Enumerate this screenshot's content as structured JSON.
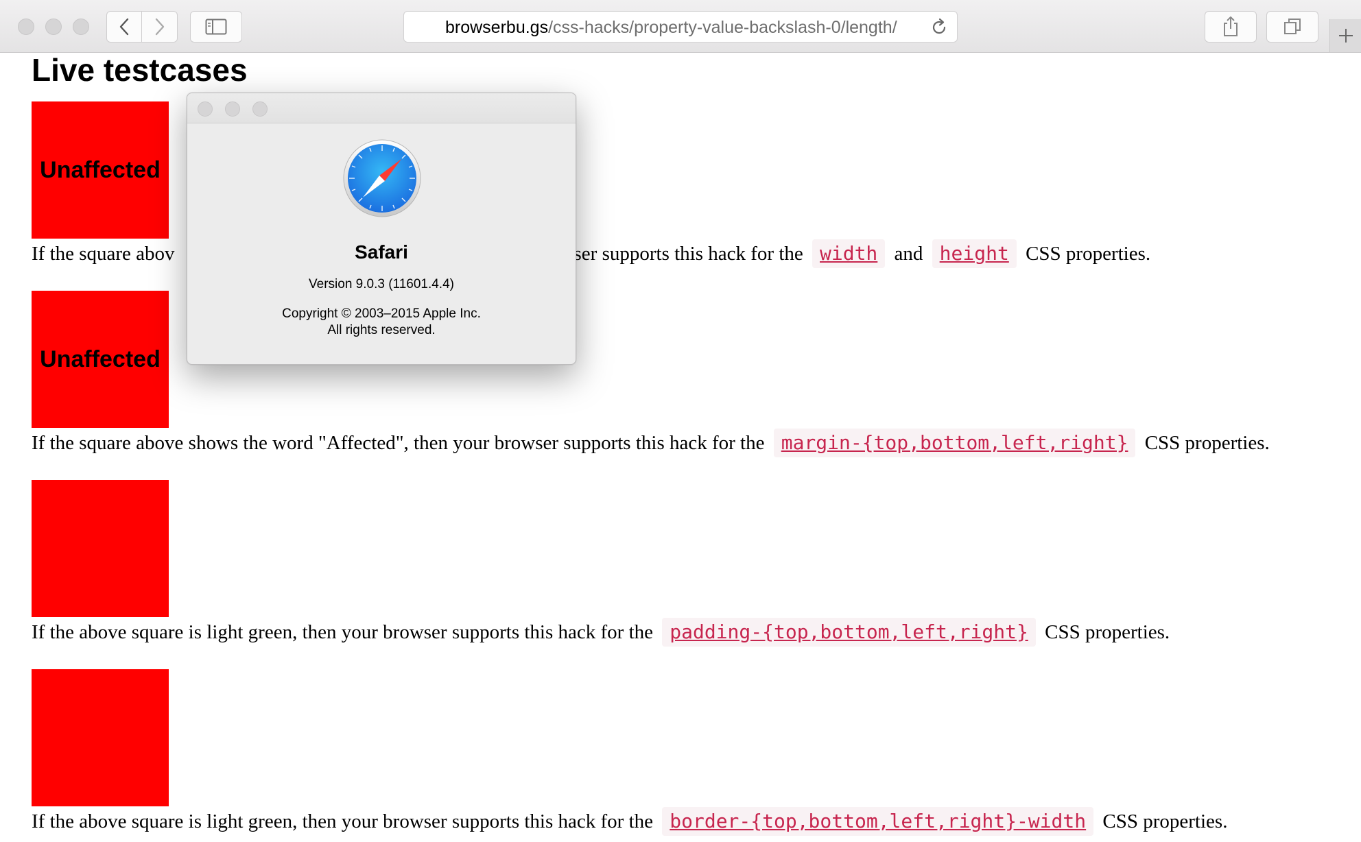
{
  "browser": {
    "url_host": "browserbu.gs",
    "url_path": "/css-hacks/property-value-backslash-0/length/"
  },
  "page": {
    "title": "Live testcases",
    "testcases": [
      {
        "square_label": "Unaffected",
        "desc_before": "If the square abov",
        "desc_mid": "wser supports this hack for the",
        "code1": "width",
        "joiner": "and",
        "code2": "height",
        "desc_after": "CSS properties."
      },
      {
        "square_label": "Unaffected",
        "desc_before": "If the square above shows the word \"Affected\", then your browser supports this hack for the",
        "code": "margin-{top,bottom,left,right}",
        "desc_after": "CSS properties."
      },
      {
        "square_label": "",
        "desc_before": "If the above square is light green, then your browser supports this hack for the",
        "code": "padding-{top,bottom,left,right}",
        "desc_after": "CSS properties."
      },
      {
        "square_label": "",
        "desc_before": "If the above square is light green, then your browser supports this hack for the",
        "code": "border-{top,bottom,left,right}-width",
        "desc_after": "CSS properties."
      }
    ]
  },
  "about_dialog": {
    "app_name": "Safari",
    "version": "Version 9.0.3 (11601.4.4)",
    "copyright": "Copyright © 2003–2015 Apple Inc.",
    "rights": "All rights reserved."
  },
  "icons": {
    "back": "chevron-left-icon",
    "forward": "chevron-right-icon",
    "sidebar": "sidebar-icon",
    "reload": "reload-icon",
    "share": "share-icon",
    "tabs": "tabs-overview-icon",
    "new_tab": "plus-icon",
    "app": "safari-compass-icon"
  },
  "colors": {
    "square_red": "#ff0000",
    "code_text": "#c7254e",
    "code_bg": "#f9f2f4"
  }
}
